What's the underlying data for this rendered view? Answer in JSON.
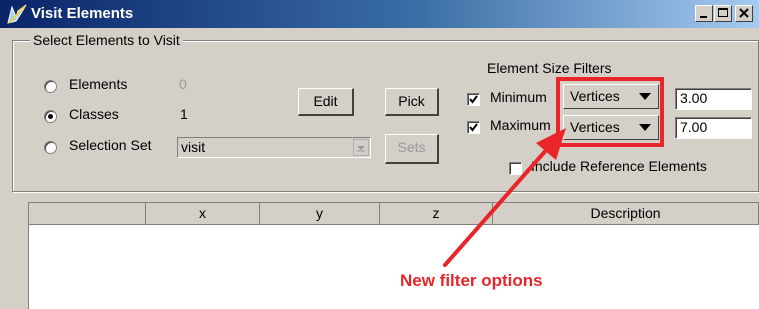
{
  "window": {
    "title": "Visit Elements",
    "icon": "app-icon",
    "controls": [
      "minimize-icon",
      "maximize-icon",
      "close-icon"
    ]
  },
  "select_group": {
    "label": "Select Elements to Visit",
    "options": [
      {
        "label": "Elements",
        "count": "0",
        "selected": false
      },
      {
        "label": "Classes",
        "count": "1",
        "selected": true
      },
      {
        "label": "Selection Set",
        "count": "",
        "selected": false
      }
    ],
    "selection_set_value": "visit",
    "edit_button": "Edit",
    "pick_button": "Pick",
    "sets_button": "Sets"
  },
  "size_filters": {
    "title": "Element Size Filters",
    "minimum": {
      "label": "Minimum",
      "checked": true,
      "mode": "Vertices",
      "value": "3.00"
    },
    "maximum": {
      "label": "Maximum",
      "checked": true,
      "mode": "Vertices",
      "value": "7.00"
    },
    "include_reference": {
      "label": "Include Reference Elements",
      "checked": false
    }
  },
  "table": {
    "columns": [
      "",
      "x",
      "y",
      "z",
      "Description"
    ]
  },
  "annotation": {
    "text": "New filter options",
    "color": "#e8262a"
  }
}
